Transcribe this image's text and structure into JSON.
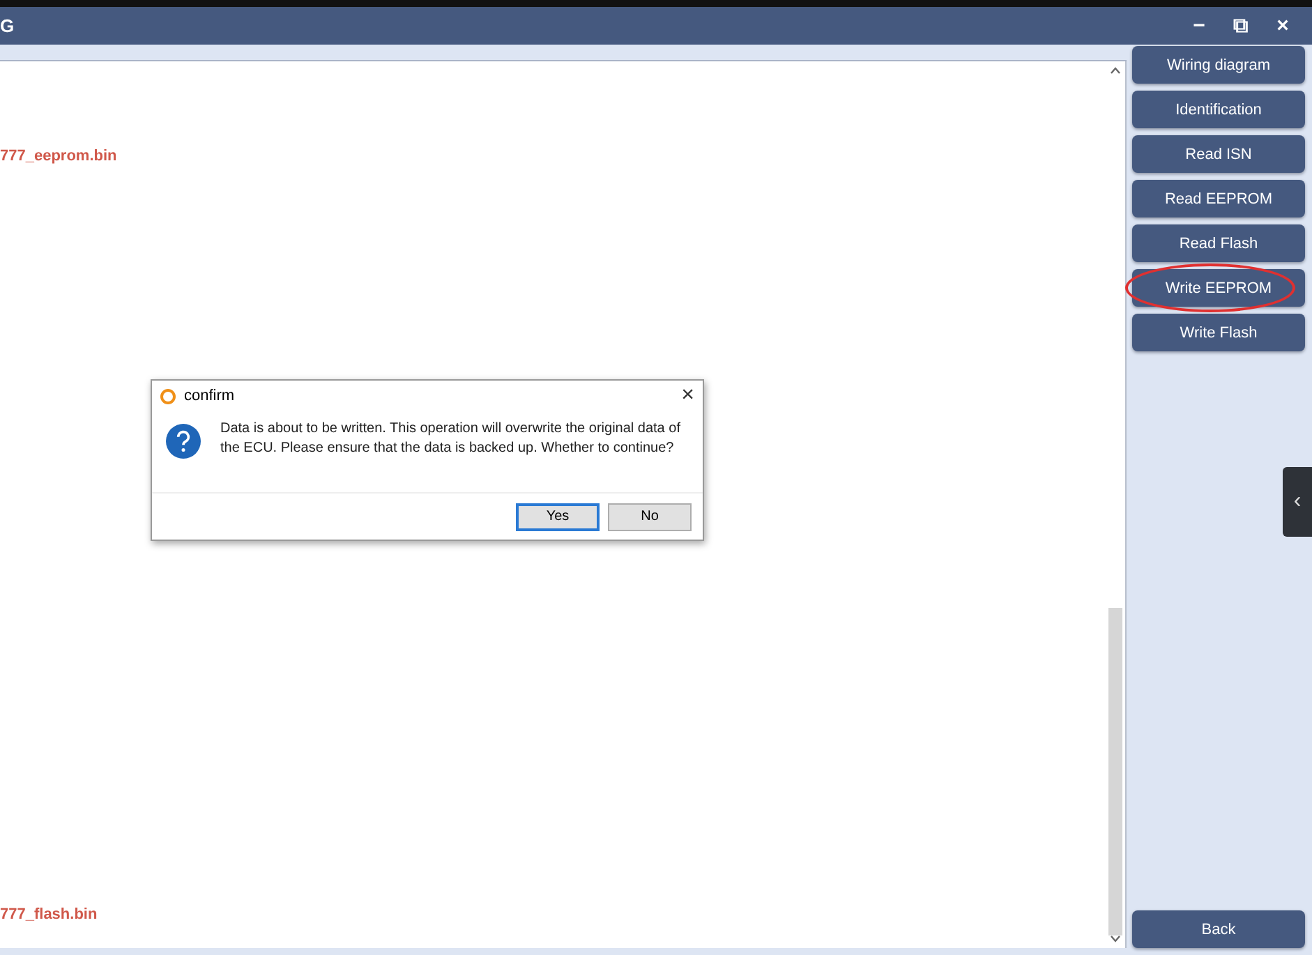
{
  "window": {
    "title": "G",
    "controls": [
      "−",
      "⧉",
      "×"
    ]
  },
  "files": [
    {
      "name": "777_eeprom.bin"
    },
    {
      "name": "777_flash.bin"
    }
  ],
  "sidebar": {
    "buttons": [
      {
        "label": "Wiring diagram",
        "highlighted": false
      },
      {
        "label": "Identification",
        "highlighted": false
      },
      {
        "label": "Read ISN",
        "highlighted": false
      },
      {
        "label": "Read EEPROM",
        "highlighted": false
      },
      {
        "label": "Read Flash",
        "highlighted": false
      },
      {
        "label": "Write EEPROM",
        "highlighted": true
      },
      {
        "label": "Write Flash",
        "highlighted": false
      }
    ],
    "back": "Back"
  },
  "side_tab": "‹",
  "dialog": {
    "title": "confirm",
    "close": "×",
    "message": "Data is about to be written. This operation will overwrite the original data of the ECU. Please ensure that the data is backed up.  Whether to continue?",
    "buttons": [
      {
        "label": "Yes",
        "selected": true
      },
      {
        "label": "No",
        "selected": false
      }
    ]
  }
}
